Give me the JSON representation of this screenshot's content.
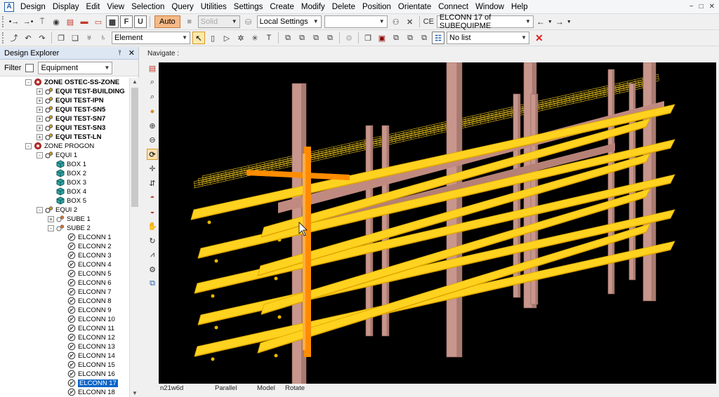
{
  "menu": {
    "items": [
      "Design",
      "Display",
      "Edit",
      "View",
      "Selection",
      "Query",
      "Utilities",
      "Settings",
      "Create",
      "Modify",
      "Delete",
      "Position",
      "Orientate",
      "Connect",
      "Window",
      "Help"
    ]
  },
  "toolbar1": {
    "auto_label": "Auto",
    "solid_label": "Solid",
    "settings_value": "Local Settings",
    "ce_label": "CE",
    "ce_value": "ELCONN 17 of SUBEQUIPME"
  },
  "toolbar2": {
    "element_value": "Element",
    "list_value": "No list"
  },
  "explorer": {
    "title": "Design Explorer",
    "filter_label": "Filter",
    "filter_value": "Equipment",
    "tree": [
      {
        "label": "ZONE OSTEC-SS-ZONE",
        "depth": 0,
        "expander": "-",
        "icon": "zone",
        "bold": true
      },
      {
        "label": "EQUI TEST-BUILDING",
        "depth": 1,
        "expander": "+",
        "icon": "equi",
        "bold": true
      },
      {
        "label": "EQUI TEST-IPN",
        "depth": 1,
        "expander": "+",
        "icon": "equi",
        "bold": true
      },
      {
        "label": "EQUI TEST-SN5",
        "depth": 1,
        "expander": "+",
        "icon": "equi",
        "bold": true
      },
      {
        "label": "EQUI TEST-SN7",
        "depth": 1,
        "expander": "+",
        "icon": "equi",
        "bold": true
      },
      {
        "label": "EQUI TEST-SN3",
        "depth": 1,
        "expander": "+",
        "icon": "equi",
        "bold": true
      },
      {
        "label": "EQUI TEST-LN",
        "depth": 1,
        "expander": "+",
        "icon": "equi",
        "bold": true
      },
      {
        "label": "ZONE PROGON",
        "depth": 0,
        "expander": "-",
        "icon": "zone",
        "bold": false
      },
      {
        "label": "EQUI 1",
        "depth": 1,
        "expander": "-",
        "icon": "equi",
        "bold": false
      },
      {
        "label": "BOX 1",
        "depth": 2,
        "expander": "",
        "icon": "box",
        "bold": false
      },
      {
        "label": "BOX 2",
        "depth": 2,
        "expander": "",
        "icon": "box",
        "bold": false
      },
      {
        "label": "BOX 3",
        "depth": 2,
        "expander": "",
        "icon": "box",
        "bold": false
      },
      {
        "label": "BOX 4",
        "depth": 2,
        "expander": "",
        "icon": "box",
        "bold": false
      },
      {
        "label": "BOX 5",
        "depth": 2,
        "expander": "",
        "icon": "box",
        "bold": false
      },
      {
        "label": "EQUI 2",
        "depth": 1,
        "expander": "-",
        "icon": "equi",
        "bold": false
      },
      {
        "label": "SUBE 1",
        "depth": 2,
        "expander": "+",
        "icon": "sube",
        "bold": false
      },
      {
        "label": "SUBE 2",
        "depth": 2,
        "expander": "-",
        "icon": "sube",
        "bold": false
      },
      {
        "label": "ELCONN 1",
        "depth": 3,
        "expander": "",
        "icon": "elconn",
        "bold": false
      },
      {
        "label": "ELCONN 2",
        "depth": 3,
        "expander": "",
        "icon": "elconn",
        "bold": false
      },
      {
        "label": "ELCONN 3",
        "depth": 3,
        "expander": "",
        "icon": "elconn",
        "bold": false
      },
      {
        "label": "ELCONN 4",
        "depth": 3,
        "expander": "",
        "icon": "elconn",
        "bold": false
      },
      {
        "label": "ELCONN 5",
        "depth": 3,
        "expander": "",
        "icon": "elconn",
        "bold": false
      },
      {
        "label": "ELCONN 6",
        "depth": 3,
        "expander": "",
        "icon": "elconn",
        "bold": false
      },
      {
        "label": "ELCONN 7",
        "depth": 3,
        "expander": "",
        "icon": "elconn",
        "bold": false
      },
      {
        "label": "ELCONN 8",
        "depth": 3,
        "expander": "",
        "icon": "elconn",
        "bold": false
      },
      {
        "label": "ELCONN 9",
        "depth": 3,
        "expander": "",
        "icon": "elconn",
        "bold": false
      },
      {
        "label": "ELCONN 10",
        "depth": 3,
        "expander": "",
        "icon": "elconn",
        "bold": false
      },
      {
        "label": "ELCONN 11",
        "depth": 3,
        "expander": "",
        "icon": "elconn",
        "bold": false
      },
      {
        "label": "ELCONN 12",
        "depth": 3,
        "expander": "",
        "icon": "elconn",
        "bold": false
      },
      {
        "label": "ELCONN 13",
        "depth": 3,
        "expander": "",
        "icon": "elconn",
        "bold": false
      },
      {
        "label": "ELCONN 14",
        "depth": 3,
        "expander": "",
        "icon": "elconn",
        "bold": false
      },
      {
        "label": "ELCONN 15",
        "depth": 3,
        "expander": "",
        "icon": "elconn",
        "bold": false
      },
      {
        "label": "ELCONN 16",
        "depth": 3,
        "expander": "",
        "icon": "elconn",
        "bold": false
      },
      {
        "label": "ELCONN 17",
        "depth": 3,
        "expander": "",
        "icon": "elconn",
        "bold": false,
        "selected": true
      },
      {
        "label": "ELCONN 18",
        "depth": 3,
        "expander": "",
        "icon": "elconn",
        "bold": false
      }
    ]
  },
  "viewer": {
    "title": "Navigate :",
    "status": {
      "direction": "n21w6d",
      "projection": "Parallel",
      "mode": "Model",
      "action": "Rotate"
    }
  },
  "colors": {
    "tray": "#ffd21f",
    "column": "#c8968c",
    "highlight": "#ff8c00",
    "selection": "#0a64c8",
    "canvas": "#000000"
  }
}
